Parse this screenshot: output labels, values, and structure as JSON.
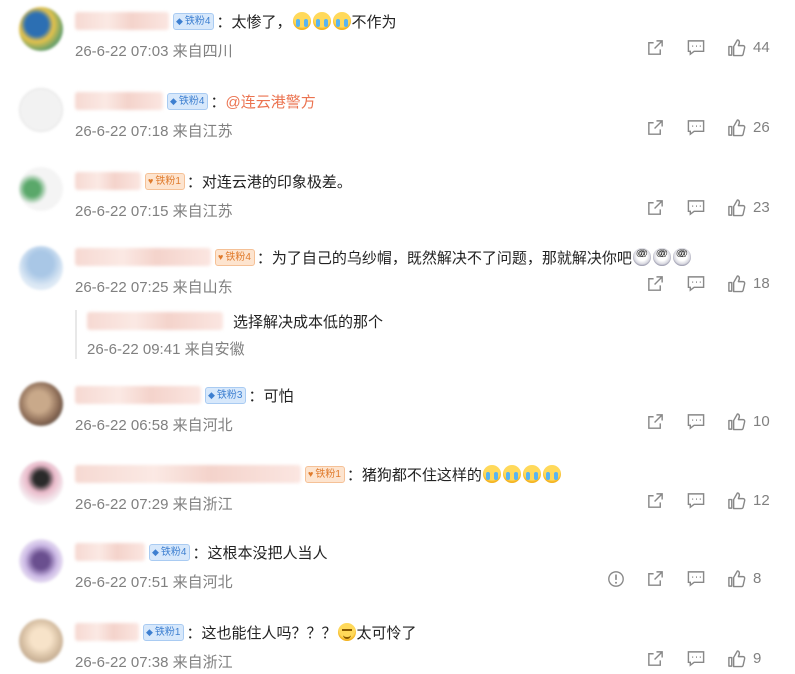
{
  "comments": [
    {
      "badge": "铁粉4",
      "badge_color": "blue",
      "text": "：太惨了，",
      "text_after": "不作为",
      "emoji_count": 3,
      "emoji_type": "cry",
      "time": "26-6-22 07:03",
      "location": "来自四川",
      "likes": "44"
    },
    {
      "badge": "铁粉4",
      "badge_color": "blue",
      "text": "：",
      "mention": "@连云港警方",
      "time": "26-6-22 07:18",
      "location": "来自江苏",
      "likes": "26"
    },
    {
      "badge": "铁粉1",
      "badge_color": "orange",
      "text": "：对连云港的印象极差。",
      "time": "26-6-22 07:15",
      "location": "来自江苏",
      "likes": "23"
    },
    {
      "badge": "铁粉4",
      "badge_color": "orange",
      "text": "：为了自己的乌纱帽，既然解决不了问题，那就解决你吧",
      "emoji_count": 3,
      "emoji_type": "dizzy",
      "time": "26-6-22 07:25",
      "location": "来自山东",
      "likes": "18",
      "reply": {
        "text": "选择解决成本低的那个",
        "time": "26-6-22 09:41",
        "location": "来自安徽"
      }
    },
    {
      "badge": "铁粉3",
      "badge_color": "blue",
      "text": "：可怕",
      "time": "26-6-22 06:58",
      "location": "来自河北",
      "likes": "10"
    },
    {
      "badge": "铁粉1",
      "badge_color": "orange",
      "text": "：猪狗都不住这样的",
      "emoji_count": 4,
      "emoji_type": "cry",
      "time": "26-6-22 07:29",
      "location": "来自浙江",
      "likes": "12"
    },
    {
      "badge": "铁粉4",
      "badge_color": "blue",
      "text": "：这根本没把人当人",
      "time": "26-6-22 07:51",
      "location": "来自河北",
      "likes": "8",
      "has_report": true
    },
    {
      "badge": "铁粉1",
      "badge_color": "blue",
      "text": "：这也能住人吗？？？",
      "text_after": "太可怜了",
      "emoji_count": 1,
      "emoji_type": "smirk",
      "time": "26-6-22 07:38",
      "location": "来自浙江",
      "likes": "9"
    }
  ],
  "icons": {
    "share": "share-icon",
    "comment": "comment-icon",
    "like": "like-icon",
    "report": "report-icon"
  },
  "colors": {
    "mention": "#eb7350",
    "meta": "#808080",
    "badge_blue": "#3d7fd0",
    "badge_orange": "#e07b2c"
  }
}
